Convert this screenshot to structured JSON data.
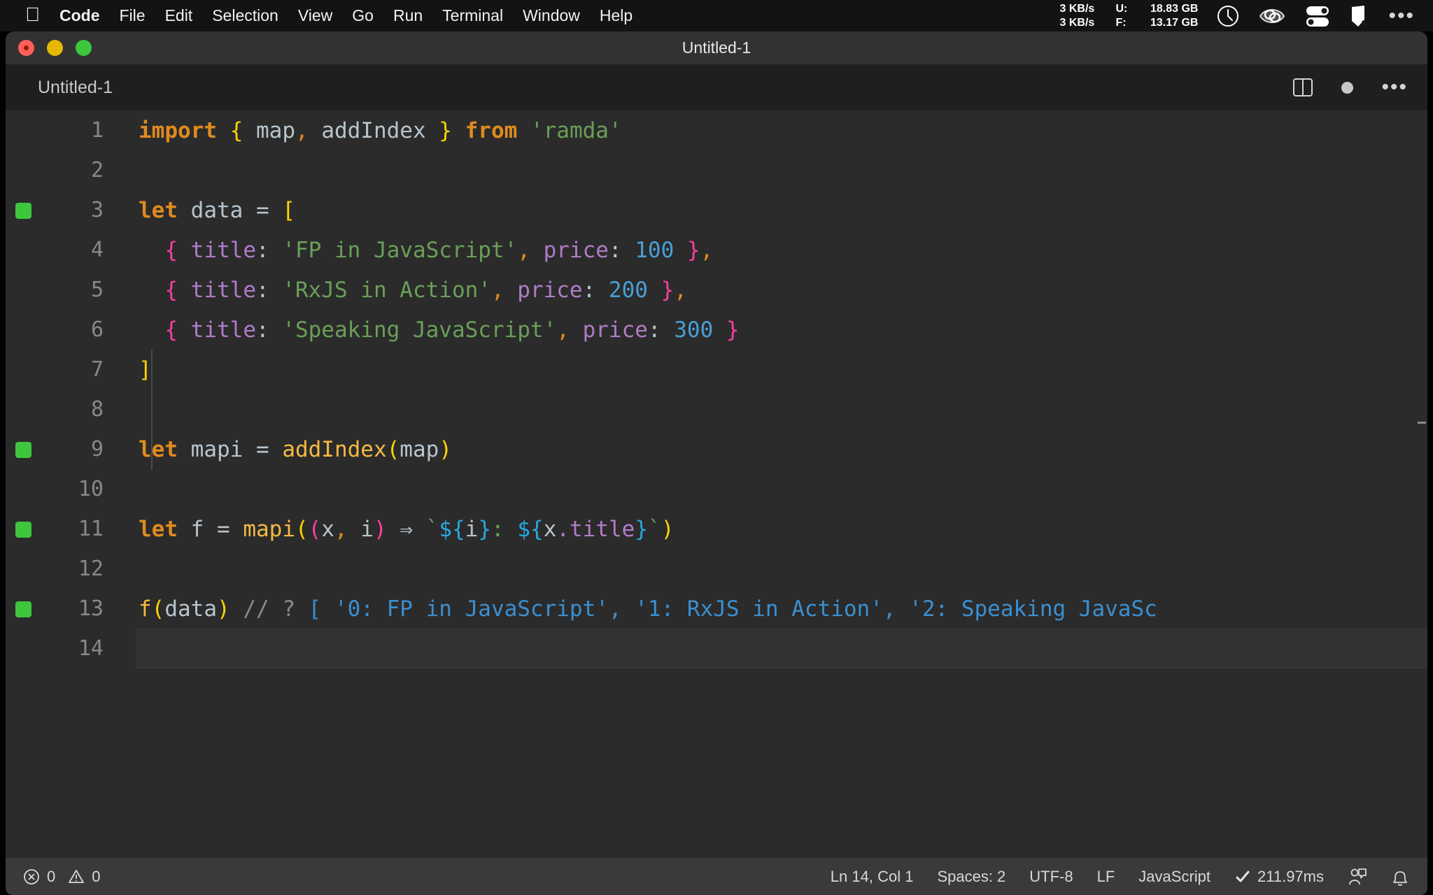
{
  "menubar": {
    "apple_icon": "apple-logo-icon",
    "items": [
      {
        "label": "Code",
        "bold": true
      },
      {
        "label": "File",
        "bold": false
      },
      {
        "label": "Edit",
        "bold": false
      },
      {
        "label": "Selection",
        "bold": false
      },
      {
        "label": "View",
        "bold": false
      },
      {
        "label": "Go",
        "bold": false
      },
      {
        "label": "Run",
        "bold": false
      },
      {
        "label": "Terminal",
        "bold": false
      },
      {
        "label": "Window",
        "bold": false
      },
      {
        "label": "Help",
        "bold": false
      }
    ],
    "network": {
      "up_speed": "3 KB/s",
      "down_speed": "3 KB/s",
      "used_label": "U:",
      "free_label": "F:",
      "used_value": "18.83 GB",
      "free_value": "13.17 GB"
    },
    "status_icons": [
      "clock-icon",
      "eye-sleep-icon",
      "toggles-icon",
      "shield-icon",
      "ellipsis-icon"
    ]
  },
  "window": {
    "title": "Untitled-1",
    "traffic_lights": [
      "close-button",
      "minimize-button",
      "maximize-button"
    ]
  },
  "editor": {
    "tab_label": "Untitled-1",
    "actions": [
      "split-editor-icon",
      "unsaved-dot-icon",
      "more-actions-icon"
    ],
    "accent_ok": "#3fc63f",
    "background": "#2b2b2b"
  },
  "code": {
    "lines": [
      {
        "n": "1",
        "ok": false
      },
      {
        "n": "2",
        "ok": false
      },
      {
        "n": "3",
        "ok": true
      },
      {
        "n": "4",
        "ok": false
      },
      {
        "n": "5",
        "ok": false
      },
      {
        "n": "6",
        "ok": false
      },
      {
        "n": "7",
        "ok": false
      },
      {
        "n": "8",
        "ok": false
      },
      {
        "n": "9",
        "ok": true
      },
      {
        "n": "10",
        "ok": false
      },
      {
        "n": "11",
        "ok": true
      },
      {
        "n": "12",
        "ok": false
      },
      {
        "n": "13",
        "ok": true
      },
      {
        "n": "14",
        "ok": false
      }
    ],
    "text": {
      "l1_import": "import",
      "l1_brace_open": "{",
      "l1_map": " map",
      "l1_comma": ",",
      "l1_addindex": " addIndex ",
      "l1_brace_close": "}",
      "l1_from": " from ",
      "l1_module": "'ramda'",
      "l3_let": "let",
      "l3_name": " data ",
      "l3_eq": "= ",
      "l3_bracket": "[",
      "l4_indent": "  ",
      "l4_open": "{",
      "l4_key": " title",
      "l4_colon": ":",
      "l4_str": " 'FP in JavaScript'",
      "l4_comma": ",",
      "l4_key2": " price",
      "l4_colon2": ":",
      "l4_num": " 100",
      "l4_close": " }",
      "l4_tail": ",",
      "l5_open": "{",
      "l5_key": " title",
      "l5_colon": ":",
      "l5_str": " 'RxJS in Action'",
      "l5_comma": ",",
      "l5_key2": " price",
      "l5_colon2": ":",
      "l5_num": " 200",
      "l5_close": " }",
      "l5_tail": ",",
      "l6_open": "{",
      "l6_key": " title",
      "l6_colon": ":",
      "l6_str": " 'Speaking JavaScript'",
      "l6_comma": ",",
      "l6_key2": " price",
      "l6_colon2": ":",
      "l6_num": " 300",
      "l6_close": " }",
      "l7_bracket": "]",
      "l9_let": "let",
      "l9_name": " mapi ",
      "l9_eq": "= ",
      "l9_fn": "addIndex",
      "l9_paren_open": "(",
      "l9_arg": "map",
      "l9_paren_close": ")",
      "l11_let": "let",
      "l11_name": " f ",
      "l11_eq": "= ",
      "l11_fn": "mapi",
      "l11_paren_open": "(",
      "l11_paren_open2": "(",
      "l11_p1": "x",
      "l11_comma": ",",
      "l11_p2": " i",
      "l11_paren_close2": ")",
      "l11_arrow": " ⇒ ",
      "l11_tick_open": "`",
      "l11_tpl1": "${",
      "l11_i": "i",
      "l11_tpl1c": "}",
      "l11_colon": ":",
      "l11_tpl2": " ${",
      "l11_x": "x",
      "l11_dot_title": ".title",
      "l11_tpl2c": "}",
      "l11_tick_close": "`",
      "l11_paren_close": ")",
      "l13_fn": "f",
      "l13_paren_open": "(",
      "l13_arg": "data",
      "l13_paren_close": ")",
      "l13_comment": " // ? ",
      "l13_result": "[ '0: FP in JavaScript', '1: RxJS in Action', '2: Speaking JavaSc"
    }
  },
  "statusbar": {
    "errors_icon": "error-circle-icon",
    "errors_count": "0",
    "warnings_icon": "warning-triangle-icon",
    "warnings_count": "0",
    "cursor_position": "Ln 14, Col 1",
    "indentation": "Spaces: 2",
    "encoding": "UTF-8",
    "eol": "LF",
    "language": "JavaScript",
    "run_status_icon": "checkmark-icon",
    "run_time": "211.97ms",
    "remote_icon": "feedback-icon",
    "bell_icon": "notifications-bell-icon"
  }
}
